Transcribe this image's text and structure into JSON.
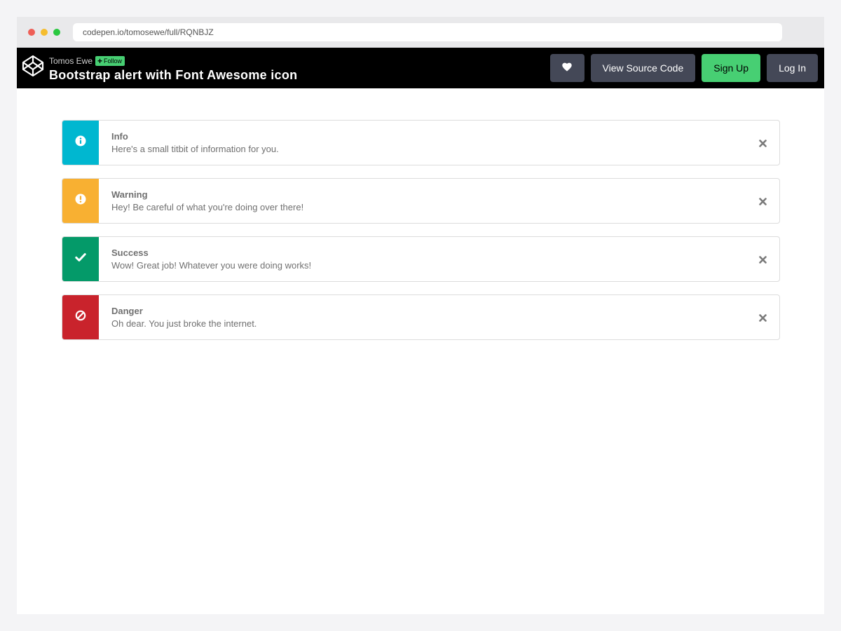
{
  "browser": {
    "url": "codepen.io/tomosewe/full/RQNBJZ",
    "dots": [
      "#ee5f57",
      "#f5bd2f",
      "#2ac840"
    ]
  },
  "header": {
    "author": "Tomos Ewe",
    "follow_label": "Follow",
    "title": "Bootstrap alert with Font Awesome icon",
    "like_icon": "heart-icon",
    "view_source_label": "View Source Code",
    "signup_label": "Sign Up",
    "login_label": "Log In"
  },
  "alerts": [
    {
      "title": "Info",
      "text": "Here's a small titbit of information for you.",
      "color": "#00b7d0",
      "icon": "info-circle-icon"
    },
    {
      "title": "Warning",
      "text": "Hey! Be careful of what you're doing over there!",
      "color": "#f8b032",
      "icon": "exclamation-circle-icon"
    },
    {
      "title": "Success",
      "text": "Wow! Great job! Whatever you were doing works!",
      "color": "#049a69",
      "icon": "check-icon"
    },
    {
      "title": "Danger",
      "text": "Oh dear. You just broke the internet.",
      "color": "#c9232c",
      "icon": "ban-icon"
    }
  ]
}
